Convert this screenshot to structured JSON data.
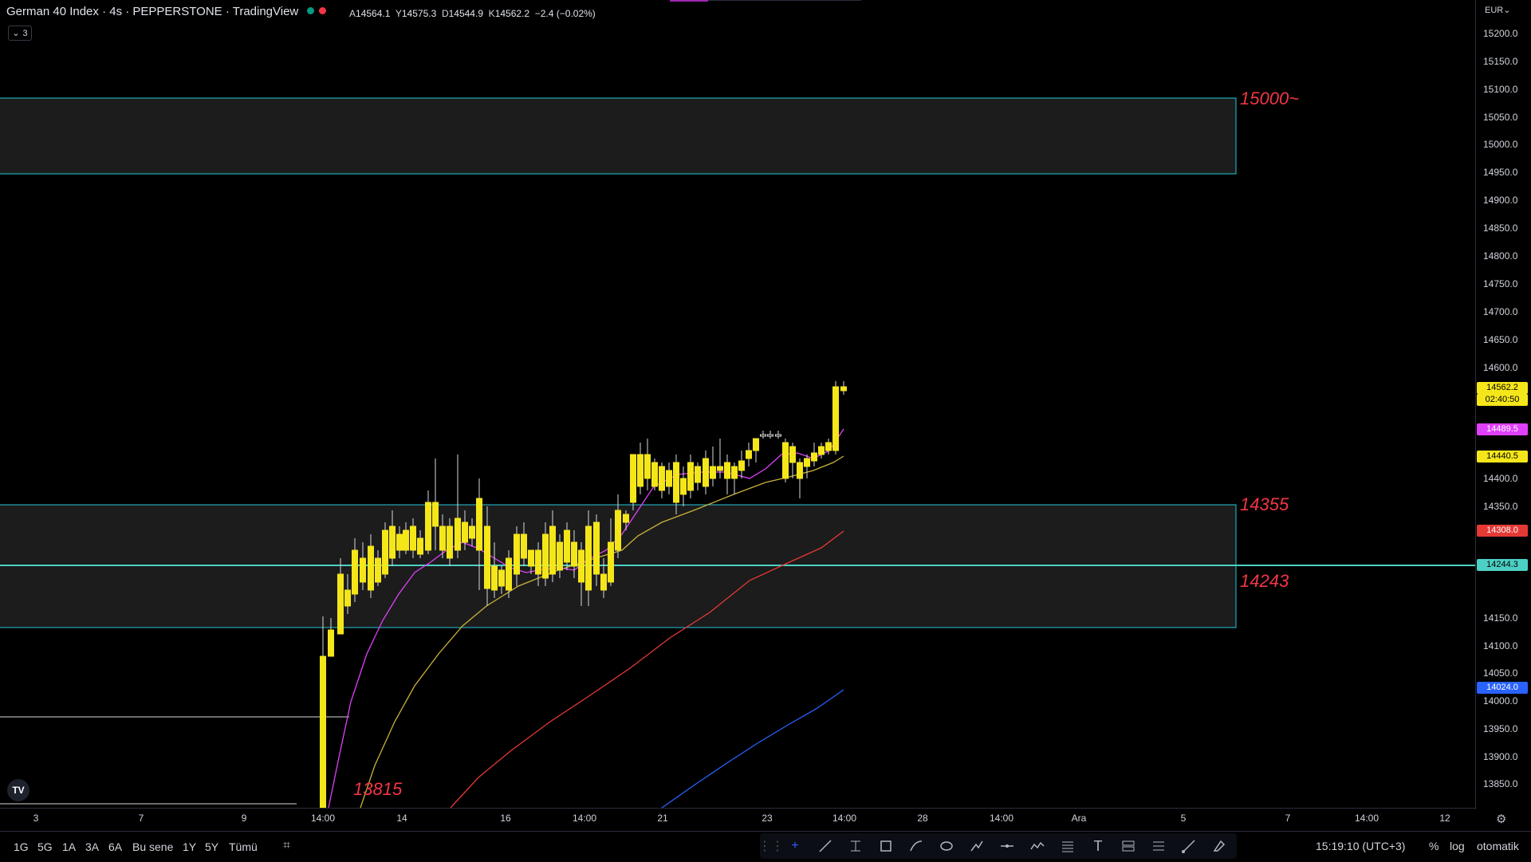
{
  "header": {
    "title": "German 40 Index · 4s · PEPPERSTONE · TradingView",
    "ohlc": [
      {
        "key": "A",
        "value": "14564.1"
      },
      {
        "key": "Y",
        "value": "14575.3"
      },
      {
        "key": "D",
        "value": "14544.9"
      },
      {
        "key": "K",
        "value": "14562.2"
      }
    ],
    "change": "−2.4 (−0.02%)",
    "indicators_count": "3"
  },
  "axis": {
    "currency": "EUR",
    "price_ticks": [
      "15200.0",
      "15150.0",
      "15100.0",
      "15050.0",
      "15000.0",
      "14950.0",
      "14900.0",
      "14850.0",
      "14800.0",
      "14750.0",
      "14700.0",
      "14650.0",
      "14600.0",
      "14400.0",
      "14350.0",
      "14150.0",
      "14100.0",
      "14050.0",
      "14000.0",
      "13950.0",
      "13900.0",
      "13850.0"
    ],
    "time_ticks": [
      "3",
      "7",
      "9",
      "14:00",
      "14",
      "16",
      "14:00",
      "21",
      "23",
      "14:00",
      "28",
      "14:00",
      "Ara",
      "5",
      "7",
      "14:00",
      "12"
    ]
  },
  "price_labels": {
    "last_price": "14562.2",
    "countdown": "02:40:50",
    "ema_magenta": "14489.5",
    "ema_yellow": "14440.5",
    "ema_red": "14308.0",
    "hline": "14244.3",
    "ema_blue": "14024.0"
  },
  "annotations": {
    "zone_top": "15000~",
    "zone_mid_top": "14355",
    "zone_mid_bottom": "14243",
    "low_label": "13815"
  },
  "bottom": {
    "timeframes": [
      "1G",
      "5G",
      "1A",
      "3A",
      "6A",
      "Bu sene",
      "1Y",
      "5Y",
      "Tümü"
    ],
    "clock": "15:19:10 (UTC+3)",
    "percent": "%",
    "log": "log",
    "auto": "otomatik"
  },
  "colors": {
    "bull": "#f5e61a",
    "zone_border": "#26c6da",
    "label_red": "#f23645",
    "ema_magenta": "#e040fb",
    "ema_yellow": "#c9b23a",
    "ema_red": "#e53935",
    "ema_blue": "#2962ff",
    "hline": "#4dd0c4"
  },
  "icons": {
    "logo": "tradingview-logo",
    "settings": "gear-icon"
  }
}
